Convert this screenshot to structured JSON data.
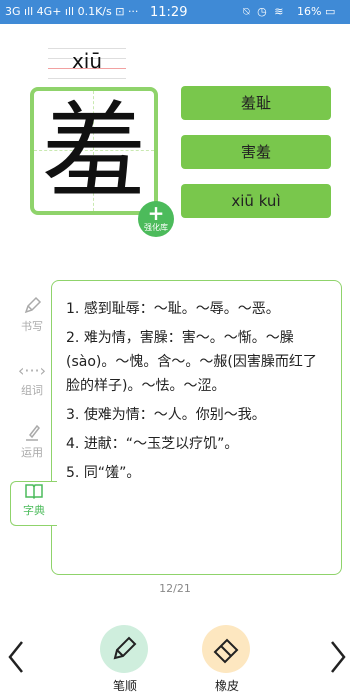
{
  "status_bar": {
    "left": "3G ıll 4G+ ıll  0.1K/s ⊡  ···",
    "time": "11:29",
    "icons": "⍉ ◷ ≋",
    "battery": "16% ▭"
  },
  "character": {
    "pinyin": "xiū",
    "glyph": "羞",
    "strengthen_label": "强化库"
  },
  "words": [
    "羞耻",
    "害羞",
    "xiū kuì"
  ],
  "side_nav": {
    "items": [
      {
        "label": "书写",
        "icon": "pen-icon"
      },
      {
        "label": "组词",
        "icon": "code-icon"
      },
      {
        "label": "运用",
        "icon": "brush-icon"
      },
      {
        "label": "字典",
        "icon": "book-icon"
      }
    ],
    "active": "字典"
  },
  "definitions": [
    {
      "num": "1.",
      "text": "感到耻辱：～耻。～辱。～恶。"
    },
    {
      "num": "2.",
      "text": "难为情，害臊：害～。～惭。～臊(sào)。～愧。含～。～赧(因害臊而红了脸的样子)。～怯。～涩。"
    },
    {
      "num": "3.",
      "text": "使难为情：～人。你别～我。"
    },
    {
      "num": "4.",
      "text": "进献：“～玉芝以疗饥”。"
    },
    {
      "num": "5.",
      "text": "同“馐”。"
    }
  ],
  "pager": "12/21",
  "toolbar": {
    "stroke_order_label": "笔顺",
    "eraser_label": "橡皮"
  },
  "colors": {
    "accent_green": "#79c74c",
    "border_green": "#8fd36b",
    "status_bar_blue": "#3f8ad6",
    "stroke_tool_bg": "#cfeedd",
    "eraser_tool_bg": "#fde7c0"
  }
}
